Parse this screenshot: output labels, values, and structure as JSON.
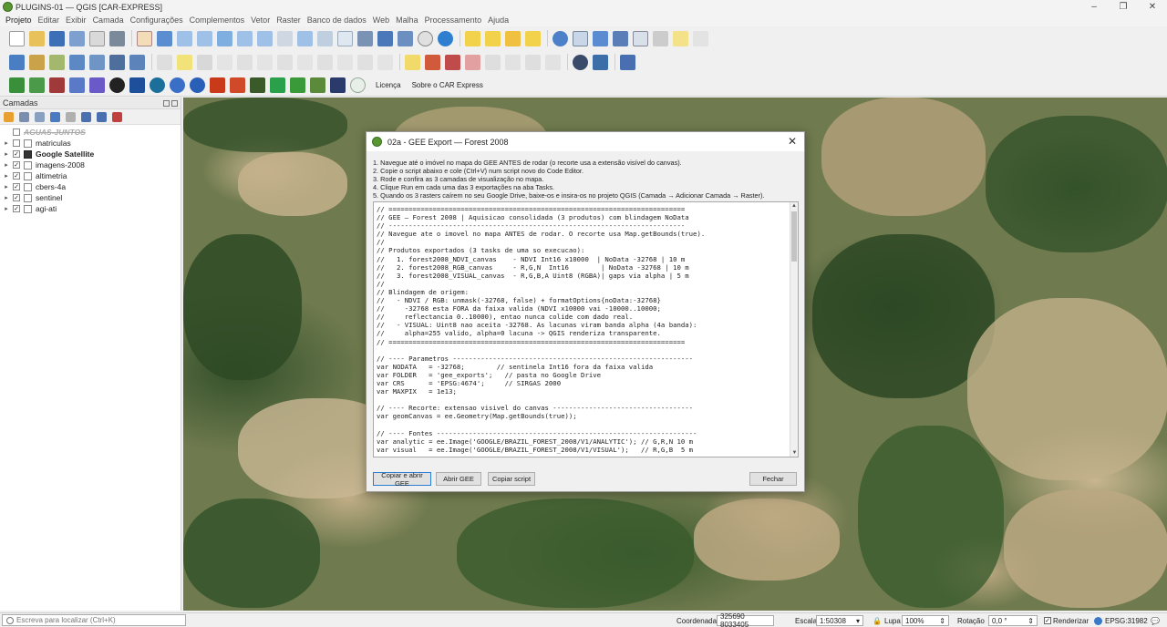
{
  "window": {
    "title": "PLUGINS-01 — QGIS [CAR-EXPRESS]",
    "controls": [
      "–",
      "❐",
      "✕"
    ]
  },
  "menu": [
    "Projeto",
    "Editar",
    "Exibir",
    "Camada",
    "Configurações",
    "Complementos",
    "Vetor",
    "Raster",
    "Banco de dados",
    "Web",
    "Malha",
    "Processamento",
    "Ajuda"
  ],
  "toolbar3_links": {
    "licenca": "Licença",
    "sobre": "Sobre o CAR Express"
  },
  "layers_panel": {
    "title": "Camadas",
    "layers": [
      {
        "name": "AGUAS-JUNTOS",
        "checked": false,
        "expand": "",
        "style": "strike"
      },
      {
        "name": "matriculas",
        "checked": false,
        "expand": "▸",
        "style": ""
      },
      {
        "name": "Google Satellite",
        "checked": true,
        "expand": "▸",
        "style": "bold"
      },
      {
        "name": "imagens-2008",
        "checked": true,
        "expand": "▸",
        "style": ""
      },
      {
        "name": "altimetria",
        "checked": true,
        "expand": "▸",
        "style": ""
      },
      {
        "name": "cbers-4a",
        "checked": true,
        "expand": "▸",
        "style": ""
      },
      {
        "name": "sentinel",
        "checked": true,
        "expand": "▸",
        "style": ""
      },
      {
        "name": "agi-ati",
        "checked": true,
        "expand": "▸",
        "style": ""
      }
    ]
  },
  "dialog": {
    "title": "02a - GEE Export — Forest 2008",
    "close": "✕",
    "instructions": [
      "1. Navegue até o imóvel no mapa do GEE ANTES de rodar (o recorte usa a extensão visível do canvas).",
      "2. Copie o script abaixo e cole (Ctrl+V) num script novo do Code Editor.",
      "3. Rode e confira as 3 camadas de visualização no mapa.",
      "4. Clique Run em cada uma das 3 exportações na aba Tasks.",
      "5. Quando os 3 rasters caírem no seu Google Drive, baixe-os e insira-os no projeto QGIS (Camada → Adicionar Camada → Raster)."
    ],
    "code": "// ==========================================================================\n// GEE — Forest 2008 | Aquisicao consolidada (3 produtos) com blindagem NoData\n// --------------------------------------------------------------------------\n// Navegue ate o imovel no mapa ANTES de rodar. O recorte usa Map.getBounds(true).\n//\n// Produtos exportados (3 tasks de uma so execucao):\n//   1. forest2008_NDVI_canvas    - NDVI Int16 x10000  | NoData -32768 | 10 m\n//   2. forest2008_RGB_canvas     - R,G,N  Int16        | NoData -32768 | 10 m\n//   3. forest2008_VISUAL_canvas  - R,G,B,A Uint8 (RGBA)| gaps via alpha | 5 m\n//\n// Blindagem de origem:\n//   - NDVI / RGB: unmask(-32768, false) + formatOptions{noData:-32768}\n//     -32768 esta FORA da faixa valida (NDVI x10000 vai -10000..10000;\n//     reflectancia 0..10000), entao nunca colide com dado real.\n//   - VISUAL: Uint8 nao aceita -32768. As lacunas viram banda alpha (4a banda):\n//     alpha=255 valido, alpha=0 lacuna -> QGIS renderiza transparente.\n// ==========================================================================\n\n// ---- Parametros ------------------------------------------------------------\nvar NODATA   = -32768;        // sentinela Int16 fora da faixa valida\nvar FOLDER   = 'gee_exports';   // pasta no Google Drive\nvar CRS      = 'EPSG:4674';     // SIRGAS 2000\nvar MAXPIX   = 1e13;\n\n// ---- Recorte: extensao visivel do canvas -----------------------------------\nvar geomCanvas = ee.Geometry(Map.getBounds(true));\n\n// ---- Fontes -----------------------------------------------------------------\nvar analytic = ee.Image('GOOGLE/BRAZIL_FOREST_2008/V1/ANALYTIC'); // G,R,N 10 m\nvar visual   = ee.Image('GOOGLE/BRAZIL_FOREST_2008/V1/VISUAL');   // R,G,B  5 m",
    "buttons": {
      "copy_open": "Copiar e abrir GEE",
      "open": "Abrir GEE",
      "copy": "Copiar script",
      "close": "Fechar"
    }
  },
  "statusbar": {
    "search_placeholder": "Escreva para localizar (Ctrl+K)",
    "coord_label": "Coordenada",
    "coord_value": "325690  8033405",
    "scale_label": "Escala",
    "scale_value": "1:50308",
    "magnifier_label": "Lupa",
    "magnifier_value": "100%",
    "rotation_label": "Rotação",
    "rotation_value": "0,0 °",
    "render_label": "Renderizar",
    "crs": "EPSG:31982"
  }
}
